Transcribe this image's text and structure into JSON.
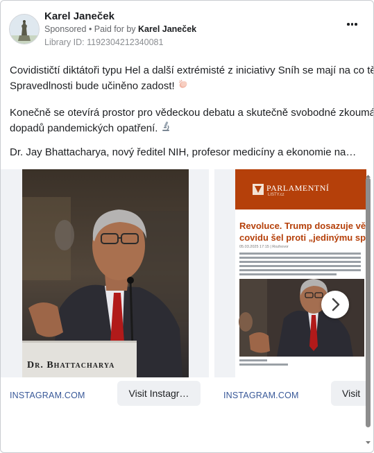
{
  "post": {
    "author": "Karel Janeček",
    "sponsored": "Sponsored",
    "paid_for_prefix": " • Paid for by ",
    "paid_for_name": "Karel Janeček",
    "library_id": "Library ID: 1192304212340081",
    "body": {
      "p1_line1": "Covidističtí diktátoři typu Hel a další extrémisté z iniciativy Sníh se mají na co těšit.",
      "p1_line2": "Spravedlnosti bude učiněno zadost!",
      "p2_line1": "Konečně se otevírá prostor pro vědeckou debatu a skutečně svobodné zkoumání",
      "p2_line2": "dopadů pandemických opatření.",
      "p3_line1": "Dr. Jay Bhattacharya, nový ředitel NIH, profesor medicíny a ekonomie na…"
    },
    "emoji": {
      "p1": "clapping-hands",
      "p2": "microscope"
    }
  },
  "carousel": {
    "cards": [
      {
        "image": "Dr. Bhattacharya speaking at a hearing",
        "nameplate": "Dr. Bhattacharya",
        "domain": "INSTAGRAM.COM",
        "cta": "Visit Instagr…"
      },
      {
        "image": "Parlamentní listy article screenshot",
        "brand": "PARLAMENTNÍ",
        "brand_sub": "LISTY.cz",
        "headline_line1": "Revoluce. Trump dosazuje vědce",
        "headline_line2": "covidu šel proti „jedinýmu správn",
        "date": "05.03.2025 17:15 | Rozhovor",
        "domain": "INSTAGRAM.COM",
        "cta": "Visit"
      }
    ]
  },
  "colors": {
    "link": "#385898",
    "brand_orange": "#b5400a",
    "headline_orange": "#b5400a",
    "tie_red": "#b11a1a"
  }
}
